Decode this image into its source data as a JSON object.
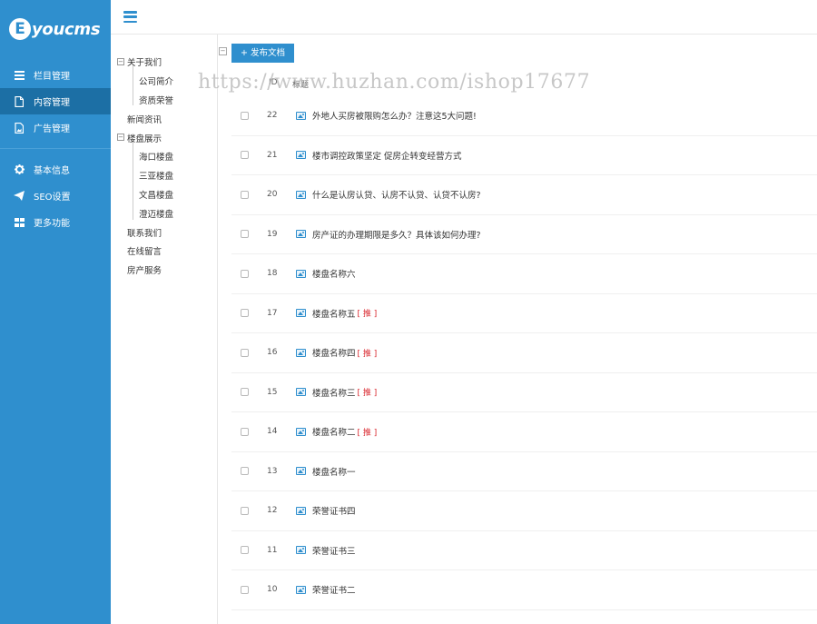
{
  "app": {
    "logo_letter": "E",
    "logo_text": "youcms"
  },
  "sidebar": {
    "items": [
      {
        "label": "栏目管理",
        "icon": "list-icon"
      },
      {
        "label": "内容管理",
        "icon": "document-icon"
      },
      {
        "label": "广告管理",
        "icon": "ad-image-icon"
      }
    ],
    "items2": [
      {
        "label": "基本信息",
        "icon": "gear-icon"
      },
      {
        "label": "SEO设置",
        "icon": "paper-plane-icon"
      },
      {
        "label": "更多功能",
        "icon": "grid-icon"
      }
    ]
  },
  "tree": {
    "nodes": [
      {
        "label": "关于我们",
        "toggle": "−"
      },
      {
        "label": "公司简介"
      },
      {
        "label": "资质荣誉"
      },
      {
        "label": "新闻资讯"
      },
      {
        "label": "楼盘展示",
        "toggle": "−"
      },
      {
        "label": "海口楼盘"
      },
      {
        "label": "三亚楼盘"
      },
      {
        "label": "文昌楼盘"
      },
      {
        "label": "澄迈楼盘"
      },
      {
        "label": "联系我们"
      },
      {
        "label": "在线留言"
      },
      {
        "label": "房产服务"
      }
    ]
  },
  "main": {
    "publish_label": "+ 发布文档",
    "collapse_symbol": "−",
    "watermark": "https://www.huzhan.com/ishop17677",
    "header_id": "ID",
    "header_title": "标题",
    "flag_label": "[ 推 ]",
    "rows": [
      {
        "id": "22",
        "title": "外地人买房被限购怎么办？注意这5大问题!",
        "flag": ""
      },
      {
        "id": "21",
        "title": "楼市调控政策坚定 促房企转变经营方式",
        "flag": ""
      },
      {
        "id": "20",
        "title": "什么是认房认贷、认房不认贷、认贷不认房?",
        "flag": ""
      },
      {
        "id": "19",
        "title": "房产证的办理期限是多久？具体该如何办理?",
        "flag": ""
      },
      {
        "id": "18",
        "title": "楼盘名称六",
        "flag": ""
      },
      {
        "id": "17",
        "title": "楼盘名称五",
        "flag": "[ 推 ]"
      },
      {
        "id": "16",
        "title": "楼盘名称四",
        "flag": "[ 推 ]"
      },
      {
        "id": "15",
        "title": "楼盘名称三",
        "flag": "[ 推 ]"
      },
      {
        "id": "14",
        "title": "楼盘名称二",
        "flag": "[ 推 ]"
      },
      {
        "id": "13",
        "title": "楼盘名称一",
        "flag": ""
      },
      {
        "id": "12",
        "title": "荣誉证书四",
        "flag": ""
      },
      {
        "id": "11",
        "title": "荣誉证书三",
        "flag": ""
      },
      {
        "id": "10",
        "title": "荣誉证书二",
        "flag": ""
      }
    ]
  },
  "colors": {
    "sidebar": "#2f8fce",
    "active": "#1c6fa5",
    "flag": "#d9272e"
  }
}
